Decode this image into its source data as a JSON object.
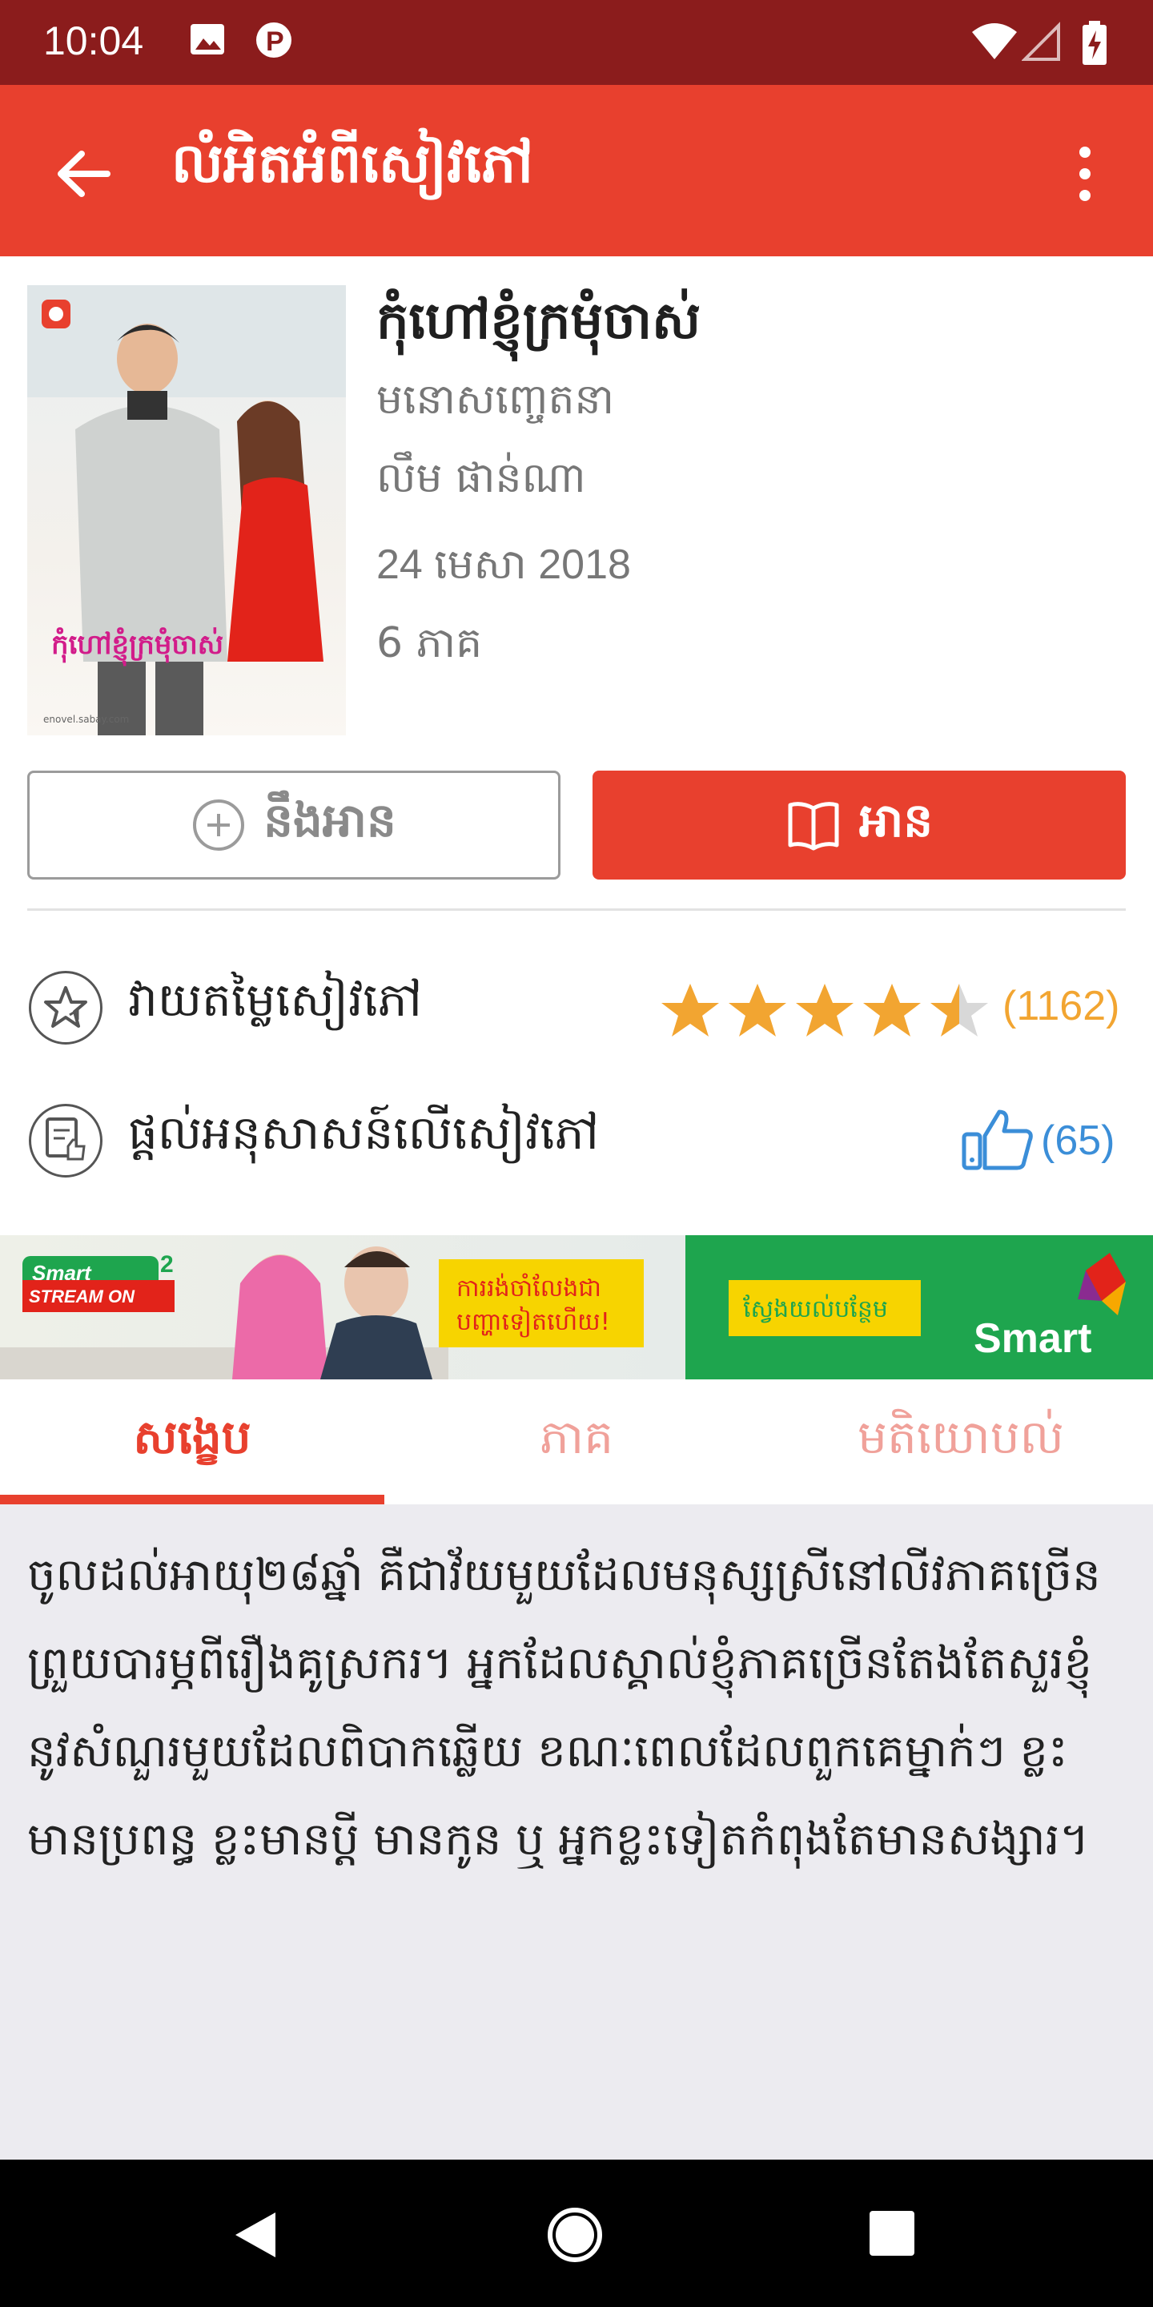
{
  "status_bar": {
    "time": "10:04"
  },
  "app_bar": {
    "title": "លំអិតអំពីសៀវភៅ"
  },
  "book": {
    "title": "កុំហៅខ្ញុំក្រមុំចាស់",
    "category": "មនោសញ្ចេតនា",
    "author": "លឹម ផាន់ណា",
    "date": "24 មេសា 2018",
    "parts": "6 ភាគ",
    "cover_title": "កុំហៅខ្ញុំក្រមុំចាស់",
    "cover_site": "enovel.sabay.com"
  },
  "buttons": {
    "read_later": "នឹងអាន",
    "read": "អាន"
  },
  "rating": {
    "label": "វាយតម្លៃសៀវភៅ",
    "count": "(1162)",
    "stars": 4.5,
    "star_color": "#f2a531"
  },
  "comment": {
    "label": "ផ្តល់អនុសាសន៍លើសៀវភៅ",
    "likes": "(65)"
  },
  "ad": {
    "brand_left": "Smart",
    "stream_text": "STREAM ON",
    "stream_sup": "2",
    "promo_text_1": "ការរង់ចាំលែងជា",
    "promo_text_2": "បញ្ហាទៀតហើយ!",
    "cta_text": "ស្វែងយល់បន្ថែម",
    "brand_right": "Smart"
  },
  "tabs": [
    {
      "label": "សង្ខេប",
      "active": true
    },
    {
      "label": "ភាគ",
      "active": false
    },
    {
      "label": "មតិយោបល់",
      "active": false
    }
  ],
  "summary": "ចូលដល់អាយុ២៨ឆ្នាំ គឺជាវ័យមួយដែលមនុស្សស្រីនៅលីវភាគច្រើនព្រួយបារម្ភពីរឿងគូស្រករ។ អ្នកដែលស្គាល់ខ្ញុំភាគច្រើនតែងតែសួរខ្ញុំនូវសំណួរមួយដែលពិបាកឆ្លើយ ខណៈពេលដែលពួកគេម្នាក់ៗ ខ្លះមានប្រពន្ធ ខ្លះមានប្តី មានកូន ឬ អ្នកខ្លះទៀតកំពុងតែមានសង្សារ។",
  "colors": {
    "primary": "#e8402e",
    "status_bar": "#8b1c1c",
    "star": "#f2a531",
    "like": "#3b8ed8",
    "ad_green": "#1ea54e"
  }
}
